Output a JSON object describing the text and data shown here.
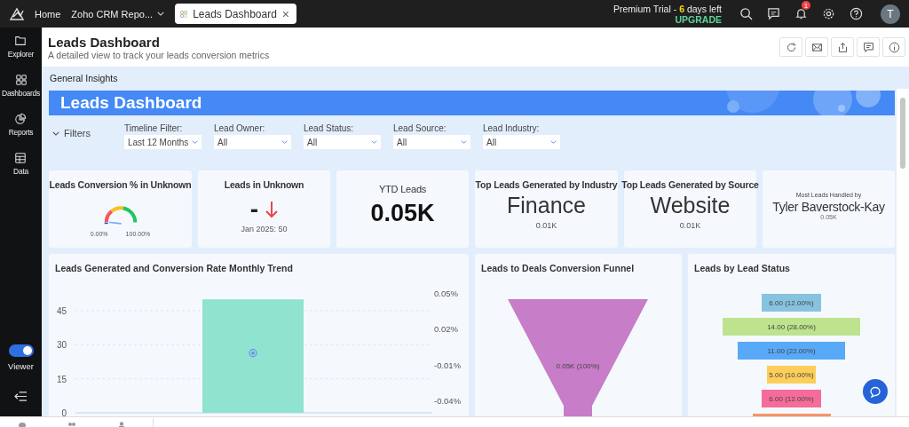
{
  "topbar": {
    "home": "Home",
    "workspace": "Zoho CRM Repo...",
    "tabs": [
      {
        "label": "Leads Dashboard",
        "selected": true,
        "close": "×"
      }
    ],
    "trial": {
      "prefix": "Premium Trial -",
      "days": "6",
      "suffix": "days left"
    },
    "upgrade": "UPGRADE",
    "notification_count": "1",
    "avatar": "T"
  },
  "sidebar": {
    "items": [
      {
        "label": "Explorer"
      },
      {
        "label": "Dashboards"
      },
      {
        "label": "Reports"
      },
      {
        "label": "Data"
      }
    ],
    "viewer": {
      "label": "Viewer",
      "on": true
    }
  },
  "header": {
    "title": "Leads Dashboard",
    "subtitle": "A detailed view to track your leads conversion metrics"
  },
  "tabs": [
    {
      "label": "General Insights",
      "selected": true
    }
  ],
  "banner": {
    "title": "Leads Dashboard"
  },
  "filters": {
    "label": "Filters",
    "expanded": true,
    "items": [
      {
        "label": "Timeline Filter:",
        "value": "Last 12 Months"
      },
      {
        "label": "Lead Owner:",
        "value": "All"
      },
      {
        "label": "Lead Status:",
        "value": "All"
      },
      {
        "label": "Lead Source:",
        "value": "All"
      },
      {
        "label": "Lead Industry:",
        "value": "All"
      }
    ]
  },
  "kpis": [
    {
      "kind": "gauge",
      "title": "Leads Conversion % in Unknown",
      "level": 0,
      "min": "0.00%",
      "max": "100.00%"
    },
    {
      "kind": "trend",
      "title": "Leads in Unknown",
      "value": "-",
      "note": "Jan 2025: 50"
    },
    {
      "kind": "number",
      "title": "YTD Leads",
      "value": "0.05K"
    },
    {
      "kind": "top",
      "title": "Top Leads Generated by Industry",
      "value": "Finance",
      "note": "0.01K"
    },
    {
      "kind": "top",
      "title": "Top Leads Generated by Source",
      "value": "Website",
      "note": "0.01K"
    },
    {
      "kind": "person",
      "title": "Most Leads Handled by",
      "value": "Tyler Baverstock-Kay",
      "note": "0.05K"
    }
  ],
  "trend_chart": {
    "title": "Leads Generated and Conversion Rate Monthly Trend",
    "right_axis_labels": [
      "0.05%",
      "0.02%",
      "-0.01%",
      "-0.04%"
    ],
    "chart_data": {
      "type": "bar",
      "grid": true,
      "series": [
        {
          "color": "#8fe3cf",
          "values": [
            50
          ]
        },
        {
          "color": "#6f8ff0",
          "values": [
            0
          ]
        }
      ],
      "yticks": [
        0,
        15,
        30,
        45
      ],
      "ylim": [
        0,
        50
      ]
    }
  },
  "funnel": {
    "title": "Leads to Deals Conversion Funnel",
    "segments": [
      {
        "label": "0.05K (100%)",
        "color": "#c77dc8"
      }
    ]
  },
  "status_chart": {
    "title": "Leads by Lead Status",
    "stages": [
      {
        "label": "6.00 (12.00%)",
        "color": "#87c3df"
      },
      {
        "label": "14.00 (28.00%)",
        "color": "#bde38e"
      },
      {
        "label": "11.00 (22.00%)",
        "color": "#58a9f7"
      },
      {
        "label": "5.00 (10.00%)",
        "color": "#fdce5a"
      },
      {
        "label": "6.00 (12.00%)",
        "color": "#f56c9a"
      },
      {
        "color": "#f5946a"
      }
    ]
  }
}
